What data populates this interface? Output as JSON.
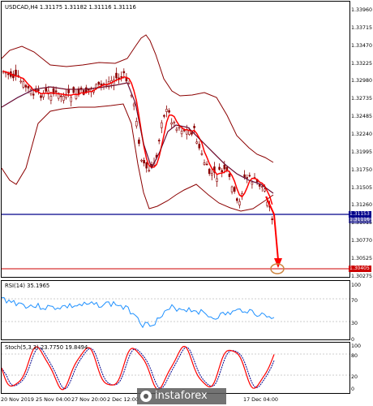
{
  "main_chart": {
    "symbol_line": "USDCAD,H4  1.31175 1.31182 1.31116 1.31116",
    "y_labels": [
      "1.33960",
      "1.33715",
      "1.33470",
      "1.33225",
      "1.32980",
      "1.32735",
      "1.32485",
      "1.32240",
      "1.31995",
      "1.31750",
      "1.31505",
      "1.31260",
      "1.31015",
      "1.30770",
      "1.30525",
      "1.30275"
    ],
    "current_price_tag": "1.31153",
    "current_price_tag_2": "1.31116",
    "target_price_tag": "1.30405",
    "colors": {
      "price_line": "#00008b",
      "target_line": "#cc0000",
      "candles": "#8b0000",
      "bollinger": "#8b0000",
      "ma_fast": "#ff0000",
      "ma_slow": "#4169e1",
      "arrow": "#ff0000",
      "circle": "#cd853f"
    }
  },
  "rsi": {
    "title": "RSI(14) 35.1965",
    "y_labels": [
      "100",
      "70",
      "30",
      "0"
    ],
    "color": "#1e90ff"
  },
  "stoch": {
    "title": "Stoch(5,3,3) 23.7750 19.8494",
    "y_labels": [
      "100",
      "80",
      "20",
      "0"
    ],
    "main_color": "#ff0000",
    "signal_color": "#00008b"
  },
  "x_axis": {
    "labels": [
      "20 Nov 2019",
      "25 Nov 04:00",
      "27 Nov 20:00",
      "2 Dec 12:00",
      "",
      "",
      "",
      "17 Dec 04:00"
    ]
  },
  "watermark": {
    "text": "instaforex"
  }
}
